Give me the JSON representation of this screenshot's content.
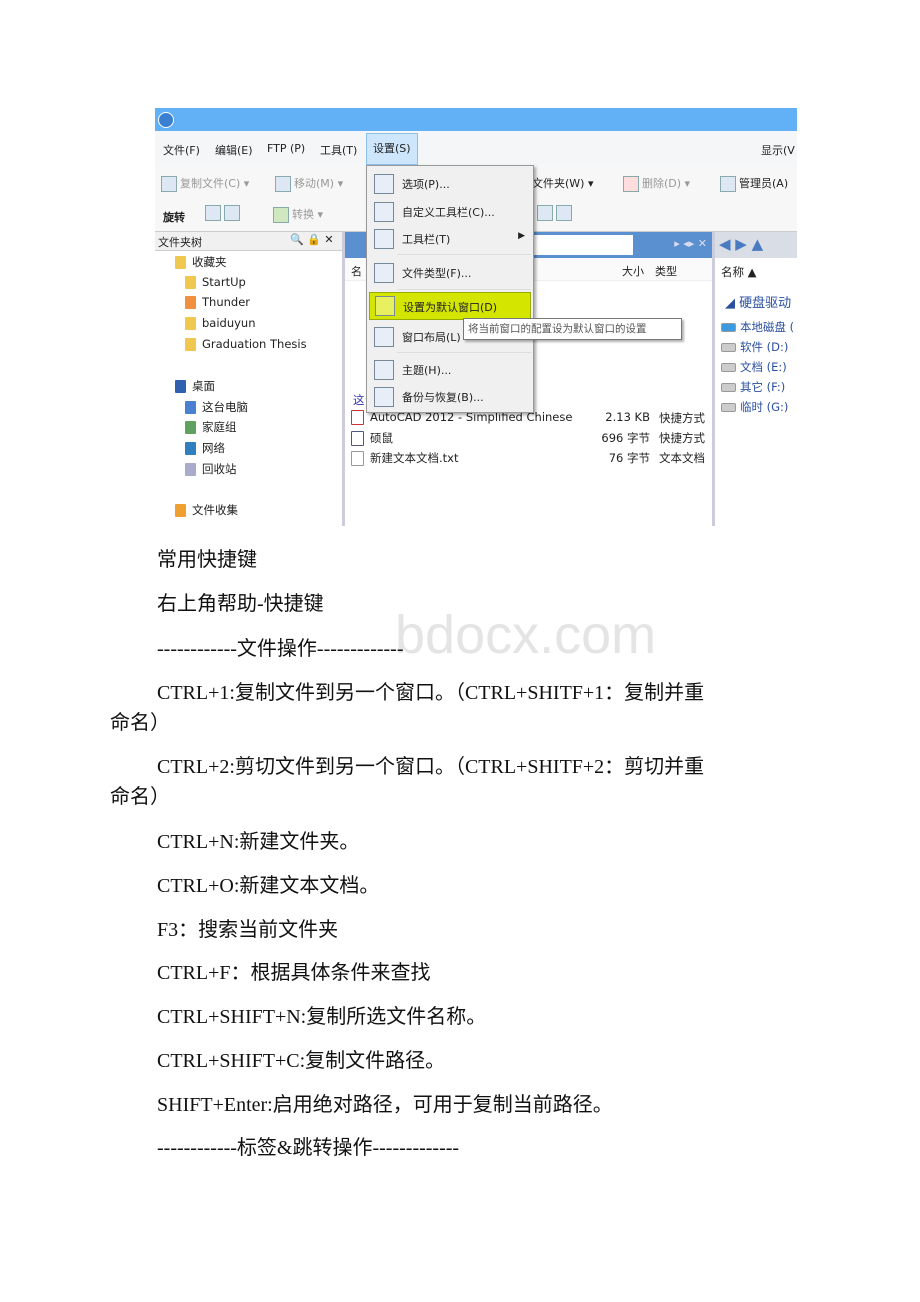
{
  "screenshot": {
    "menubar": [
      "文件(F)",
      "编辑(E)",
      "FTP (P)",
      "工具(T)",
      "设置(S)",
      "显示(V"
    ],
    "toolbar1": [
      "复制文件(C)",
      "移动(M)",
      "文件夹(W)",
      "删除(D)",
      "管理员(A)"
    ],
    "toolbar2": [
      "旋转",
      "转换"
    ],
    "left_pane": {
      "title": "文件夹树",
      "items": [
        "收藏夹",
        "StartUp",
        "Thunder",
        "baiduyun",
        "Graduation Thesis",
        "桌面",
        "这台电脑",
        "家庭组",
        "网络",
        "回收站",
        "文件收集"
      ]
    },
    "mid_pane": {
      "columns": [
        "名",
        "大小",
        "类型"
      ],
      "partial_item": "这台电脑",
      "files": [
        {
          "name": "AutoCAD 2012 - Simplified Chinese",
          "size": "2.13 KB",
          "type": "快捷方式"
        },
        {
          "name": "硕鼠",
          "size": "696 字节",
          "type": "快捷方式"
        },
        {
          "name": "新建文本文档.txt",
          "size": "76 字节",
          "type": "文本文档"
        }
      ]
    },
    "right_pane": {
      "column": "名称",
      "group": "硬盘驱动",
      "drives": [
        "本地磁盘 (",
        "软件 (D:)",
        "文档 (E:)",
        "其它 (F:)",
        "临时 (G:)"
      ]
    },
    "settings_menu": [
      "选项(P)...",
      "自定义工具栏(C)...",
      "工具栏(T)",
      "文件类型(F)...",
      "设置为默认窗口(D)",
      "窗口布局(L)",
      "主题(H)...",
      "备份与恢复(B)..."
    ],
    "tooltip": "将当前窗口的配置设为默认窗口的设置",
    "highlight_color": "#d4e600"
  },
  "watermark": "www.bdocx.com",
  "lines": [
    "常用快捷键",
    "右上角帮助-快捷键",
    "------------文件操作-------------",
    "CTRL+1:复制文件到另一个窗口。（CTRL+SHITF+1：复制并重",
    "命名）",
    "CTRL+2:剪切文件到另一个窗口。（CTRL+SHITF+2：剪切并重",
    "命名）",
    "CTRL+N:新建文件夹。",
    "CTRL+O:新建文本文档。",
    "F3：搜索当前文件夹",
    "CTRL+F：根据具体条件来查找",
    "CTRL+SHIFT+N:复制所选文件名称。",
    "CTRL+SHIFT+C:复制文件路径。",
    "SHIFT+Enter:启用绝对路径，可用于复制当前路径。",
    "------------标签&跳转操作-------------"
  ]
}
